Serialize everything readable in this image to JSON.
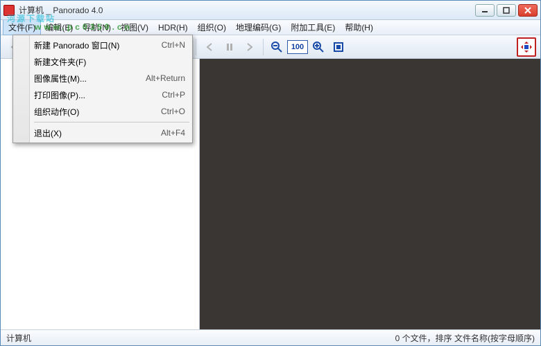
{
  "title": "计算机 _ Panorado 4.0",
  "watermark": {
    "main": "河源下载站",
    "sub": "www.pc0359.cn"
  },
  "menus": {
    "file": "文件(F)",
    "edit": "编辑(E)",
    "nav": "导航(N)",
    "view": "视图(V)",
    "hdr": "HDR(H)",
    "org": "组织(O)",
    "geo": "地理编码(G)",
    "tools": "附加工具(E)",
    "help": "帮助(H)"
  },
  "file_menu": {
    "new_window": {
      "label": "新建 Panorado 窗口(N)",
      "shortcut": "Ctrl+N"
    },
    "new_folder": {
      "label": "新建文件夹(F)",
      "shortcut": ""
    },
    "image_props": {
      "label": "图像属性(M)...",
      "shortcut": "Alt+Return"
    },
    "print": {
      "label": "打印图像(P)...",
      "shortcut": "Ctrl+P"
    },
    "org_actions": {
      "label": "组织动作(O)",
      "shortcut": "Ctrl+O"
    },
    "exit": {
      "label": "退出(X)",
      "shortcut": "Alt+F4"
    }
  },
  "toolbar": {
    "zoom_value": "100"
  },
  "status": {
    "left": "计算机",
    "right": "0 个文件，排序 文件名称(按字母顺序)"
  }
}
